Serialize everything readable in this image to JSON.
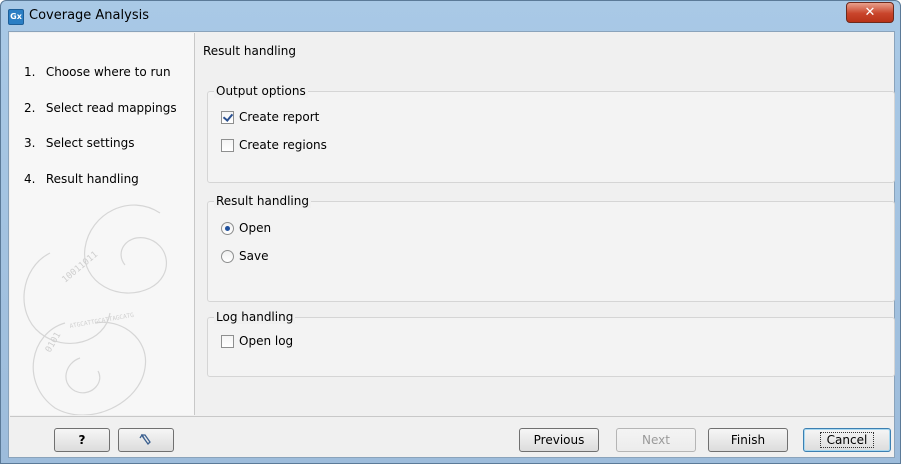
{
  "window": {
    "title": "Coverage Analysis",
    "app_icon_text": "Gx",
    "close_glyph": "✕"
  },
  "steps": [
    {
      "num": "1.",
      "label": "Choose where to run"
    },
    {
      "num": "2.",
      "label": "Select read mappings"
    },
    {
      "num": "3.",
      "label": "Select settings"
    },
    {
      "num": "4.",
      "label": "Result handling"
    }
  ],
  "content": {
    "section_title": "Result handling",
    "output_options": {
      "legend": "Output options",
      "create_report": {
        "label": "Create report",
        "checked": true
      },
      "create_regions": {
        "label": "Create regions",
        "checked": false
      }
    },
    "result_handling": {
      "legend": "Result handling",
      "open": {
        "label": "Open",
        "selected": true
      },
      "save": {
        "label": "Save",
        "selected": false
      }
    },
    "log_handling": {
      "legend": "Log handling",
      "open_log": {
        "label": "Open log",
        "checked": false
      }
    }
  },
  "buttons": {
    "help": "?",
    "reset_icon": "reset-arrow-icon",
    "previous": "Previous",
    "next": "Next",
    "finish": "Finish",
    "cancel": "Cancel"
  }
}
